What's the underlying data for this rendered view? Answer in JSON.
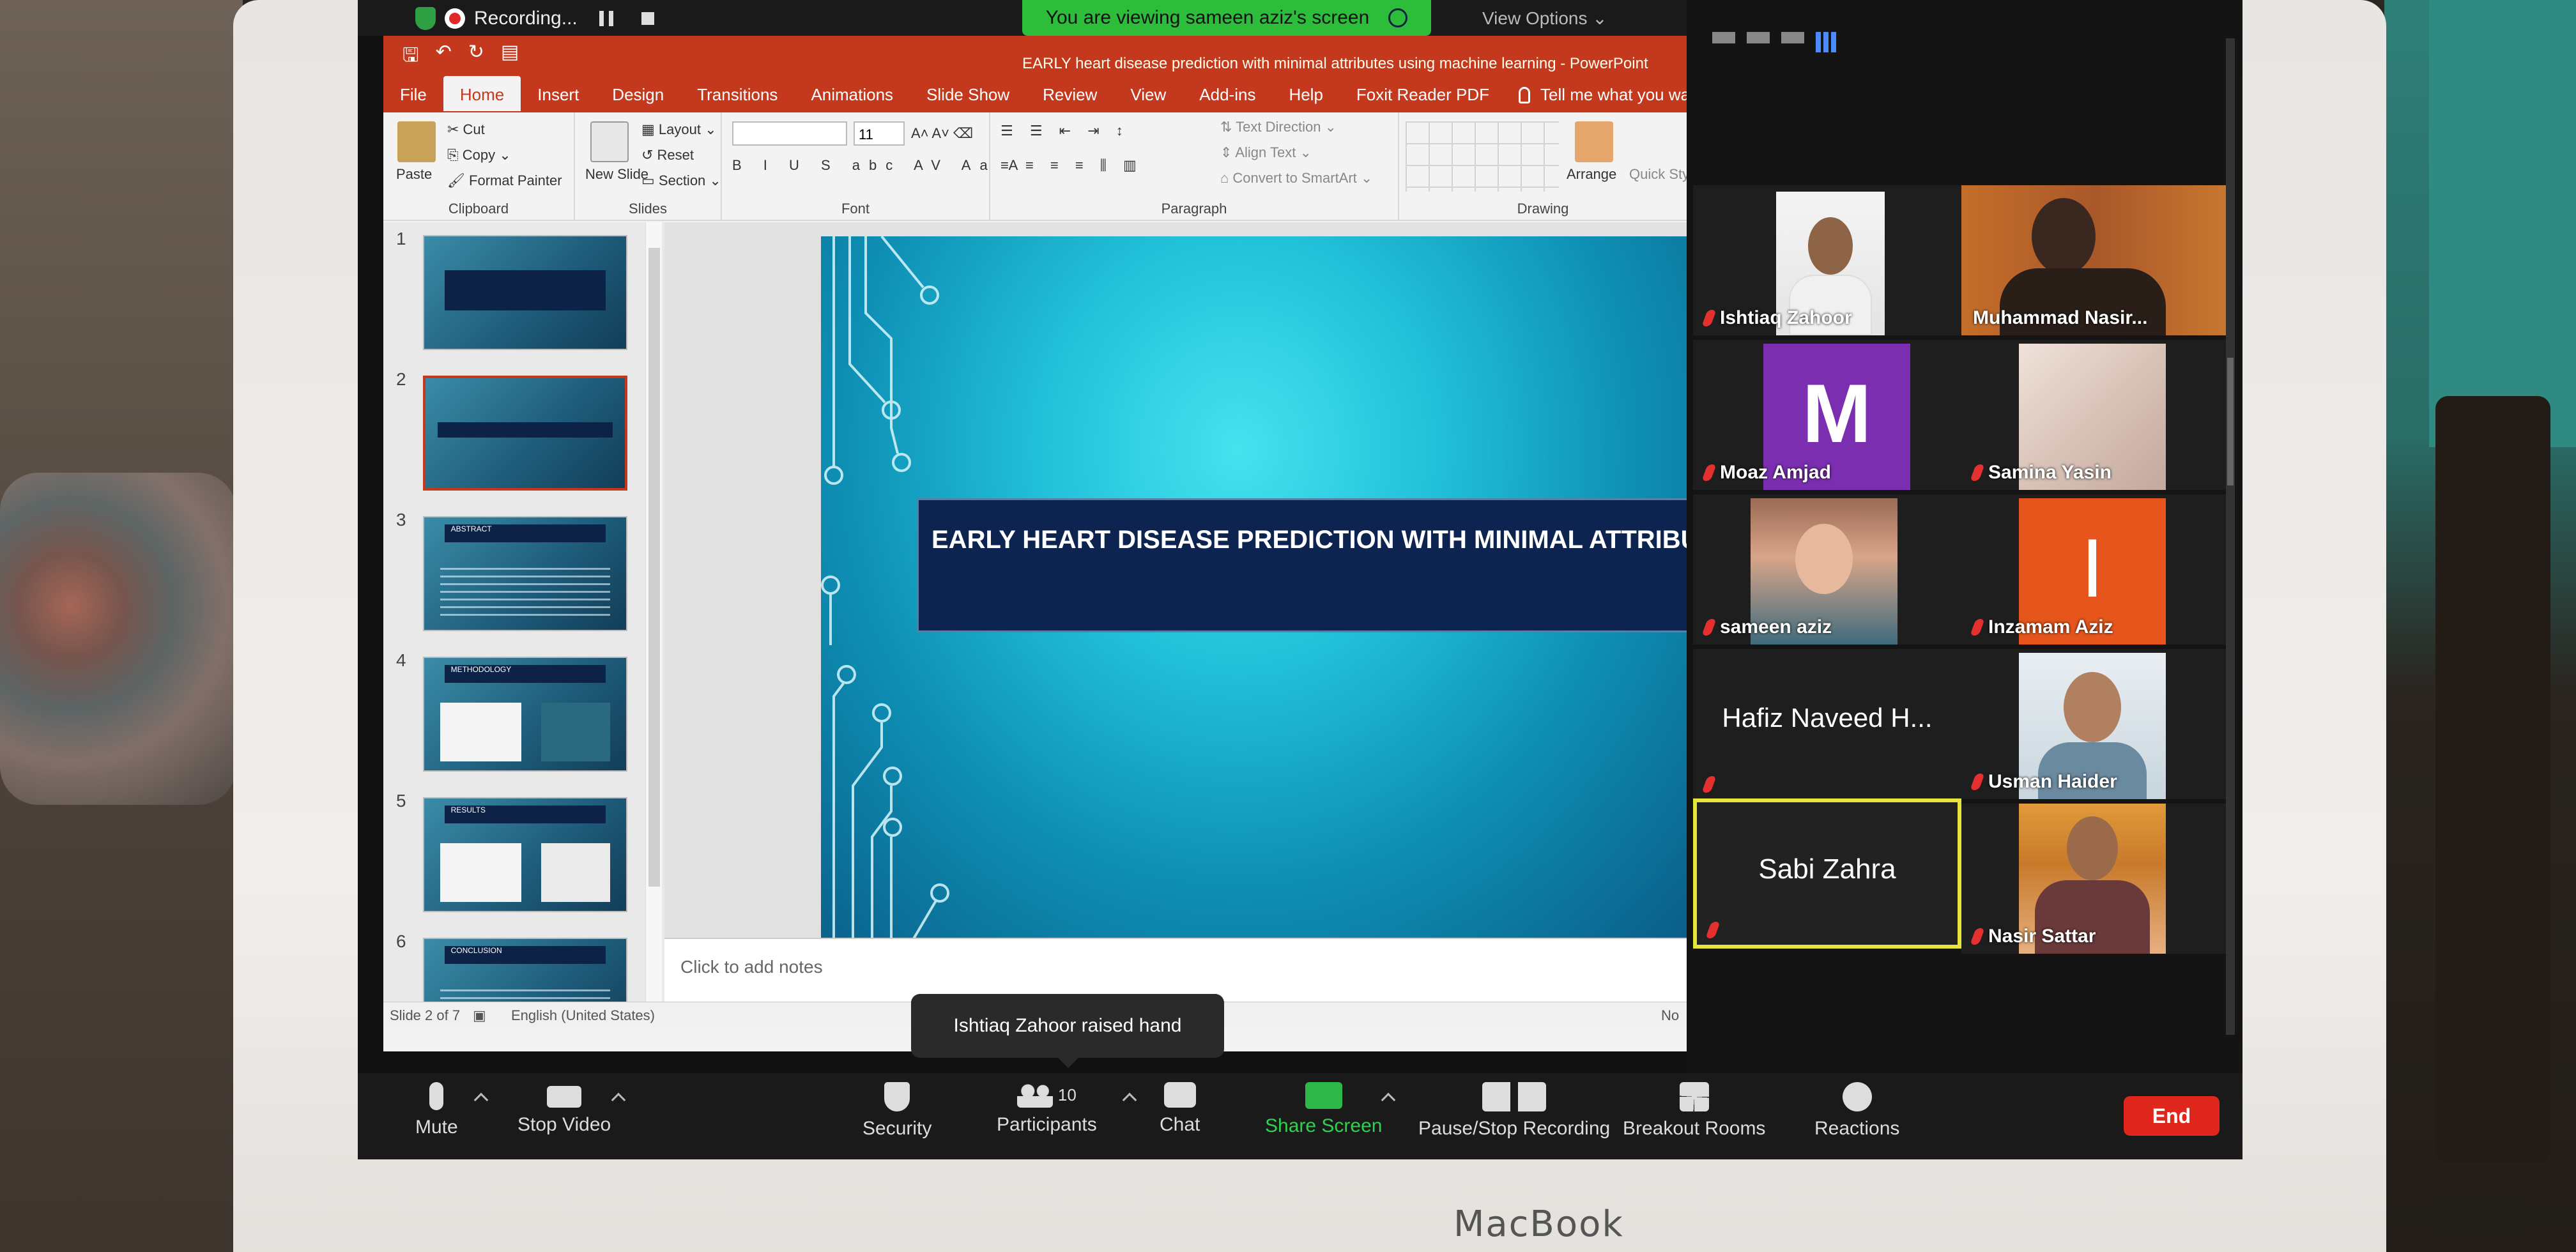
{
  "zoom": {
    "recording_label": "Recording...",
    "viewing_banner": "You are viewing sameen aziz's screen",
    "view_options": "View Options",
    "toast": "Ishtiaq Zahoor raised hand",
    "participants_count": "10",
    "toolbar": {
      "mute": "Mute",
      "stop_video": "Stop Video",
      "security": "Security",
      "participants": "Participants",
      "chat": "Chat",
      "share_screen": "Share Screen",
      "pause_stop_recording": "Pause/Stop Recording",
      "breakout_rooms": "Breakout Rooms",
      "reactions": "Reactions",
      "end": "End"
    },
    "participants": [
      {
        "name": "Ishtiaq Zahoor"
      },
      {
        "name": "Muhammad Nasir..."
      },
      {
        "name": "Moaz Amjad",
        "avatar_letter": "M",
        "avatar_color": "#7b2fb0"
      },
      {
        "name": "Samina Yasin"
      },
      {
        "name": "sameen aziz"
      },
      {
        "name": "Inzamam Aziz",
        "avatar_letter": "I",
        "avatar_color": "#e6561c"
      },
      {
        "name": "Hafiz Naveed H..."
      },
      {
        "name": "Usman Haider"
      },
      {
        "name": "Sabi Zahra"
      },
      {
        "name": "Nasir Sattar"
      }
    ]
  },
  "powerpoint": {
    "doc_title": "EARLY heart disease prediction with minimal attributes using machine learning - PowerPoint",
    "tabs": [
      "File",
      "Home",
      "Insert",
      "Design",
      "Transitions",
      "Animations",
      "Slide Show",
      "Review",
      "View",
      "Add-ins",
      "Help",
      "Foxit Reader PDF"
    ],
    "active_tab": "Home",
    "tell_me": "Tell me what you want to do",
    "ribbon": {
      "paste": "Paste",
      "cut": "Cut",
      "copy": "Copy",
      "format_painter": "Format Painter",
      "clipboard": "Clipboard",
      "new_slide": "New Slide",
      "layout": "Layout",
      "reset": "Reset",
      "section": "Section",
      "slides": "Slides",
      "font_size": "11",
      "font": "Font",
      "text_direction": "Text Direction",
      "align_text": "Align Text",
      "convert_smartart": "Convert to SmartArt",
      "paragraph": "Paragraph",
      "arrange": "Arrange",
      "quick_styles": "Quick Styles",
      "drawing": "Drawing"
    },
    "thumbnails": [
      "1",
      "2",
      "3",
      "4",
      "5",
      "6"
    ],
    "thumb_titles": {
      "3": "ABSTRACT",
      "4": "METHODOLOGY",
      "5": "RESULTS",
      "6": "CONCLUSION"
    },
    "slide_title": "EARLY HEART DISEASE PREDICTION WITH MINIMAL ATTRIBUTES",
    "notes_placeholder": "Click to add notes",
    "status_slide": "Slide 2 of 7",
    "status_language": "English (United States)",
    "status_notes": "No"
  },
  "device": {
    "brand": "MacBook"
  }
}
